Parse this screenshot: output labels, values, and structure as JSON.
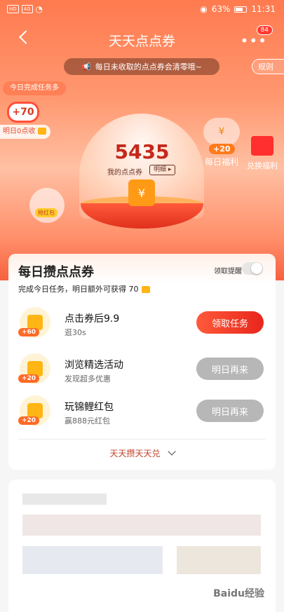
{
  "status_bar": {
    "network": "HD",
    "network2": "4G",
    "battery": "63%",
    "time": "11:31"
  },
  "nav": {
    "title": "天天点点券",
    "more_badge": "84"
  },
  "notice": "每日未收取的点点券会清零哦~",
  "rules_label": "规则",
  "task_bubble": "今日完成任务多",
  "clock": {
    "value": "+70",
    "label": "明日0点收"
  },
  "points": {
    "value": "5435",
    "label": "我的点点券",
    "detail": "明细"
  },
  "daily_reward": {
    "plus": "+20",
    "label": "每日福利"
  },
  "exchange_label": "兑换福利",
  "hongbao_label": "抢红包",
  "card": {
    "title": "每日攒点点券",
    "remind_label": "领取提醒",
    "subtitle": "完成今日任务，明日额外可获得 70",
    "tasks": [
      {
        "name": "点击券后9.9",
        "desc": "逛30s",
        "reward": "+60",
        "button": "领取任务",
        "state": "active"
      },
      {
        "name": "浏览精选活动",
        "desc": "发现超多优惠",
        "reward": "+20",
        "button": "明日再来",
        "state": "disabled"
      },
      {
        "name": "玩锦鲤红包",
        "desc": "赢888元红包",
        "reward": "+20",
        "button": "明日再来",
        "state": "disabled"
      }
    ],
    "footer": "天天攒天天兑"
  },
  "watermark": "Baidu经验",
  "colors": {
    "primary": "#ff5a3a",
    "disabled": "#b7b7b7",
    "accent_coin": "#ffb514"
  }
}
